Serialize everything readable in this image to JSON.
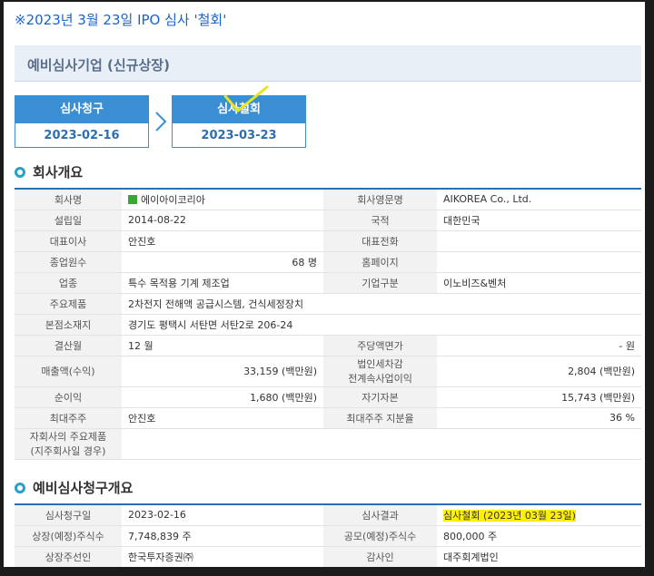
{
  "note": "※2023년 3월 23일 IPO 심사 '철회'",
  "header": {
    "title": "예비심사기업 (신규상장)"
  },
  "steps": [
    {
      "label": "심사청구",
      "date": "2023-02-16"
    },
    {
      "label": "심사철회",
      "date": "2023-03-23"
    }
  ],
  "company_section": {
    "title": "회사개요",
    "rows": [
      {
        "l1": "회사명",
        "v1": "에이아이코리아",
        "l2": "회사영문명",
        "v2": "AIKOREA Co., Ltd."
      },
      {
        "l1": "설립일",
        "v1": "2014-08-22",
        "l2": "국적",
        "v2": "대한민국"
      },
      {
        "l1": "대표이사",
        "v1": "안진호",
        "l2": "대표전화",
        "v2": ""
      },
      {
        "l1": "종업원수",
        "v1": "68 명",
        "l2": "홈페이지",
        "v2": ""
      },
      {
        "l1": "업종",
        "v1": "특수 목적용 기계 제조업",
        "l2": "기업구분",
        "v2": "이노비즈&벤처"
      },
      {
        "l1": "주요제품",
        "v1": "2차전지 전해액 공급시스템, 건식세정장치"
      },
      {
        "l1": "본점소재지",
        "v1": "경기도 평택시 서탄면 서탄2로 206-24"
      },
      {
        "l1": "결산월",
        "v1": "12 월",
        "l2": "주당액면가",
        "v2": "- 원"
      },
      {
        "l1": "매출액(수익)",
        "v1": "33,159 (백만원)",
        "l2": "법인세차감\n전계속사업이익",
        "v2": "2,804 (백만원)"
      },
      {
        "l1": "순이익",
        "v1": "1,680 (백만원)",
        "l2": "자기자본",
        "v2": "15,743 (백만원)"
      },
      {
        "l1": "최대주주",
        "v1": "안진호",
        "l2": "최대주주 지분율",
        "v2": "36 %"
      },
      {
        "l1": "자회사의 주요제품\n(지주회사일 경우)",
        "v1": ""
      }
    ]
  },
  "ipo_section": {
    "title": "예비심사청구개요",
    "rows": [
      {
        "l1": "심사청구일",
        "v1": "2023-02-16",
        "l2": "심사결과",
        "v2": "심사철회 (2023년 03월 23일)"
      },
      {
        "l1": "상장(예정)주식수",
        "v1": "7,748,839 주",
        "l2": "공모(예정)주식수",
        "v2": "800,000 주"
      },
      {
        "l1": "상장주선인",
        "v1": "한국투자증권㈜",
        "l2": "감사인",
        "v2": "대주회계법인"
      }
    ]
  },
  "colors": {
    "accent": "#3a8fd4",
    "highlight": "#fff000"
  },
  "icons": {
    "logo": "company-logo-icon",
    "arrow": "chevron-right-icon",
    "check": "check-mark-icon"
  }
}
